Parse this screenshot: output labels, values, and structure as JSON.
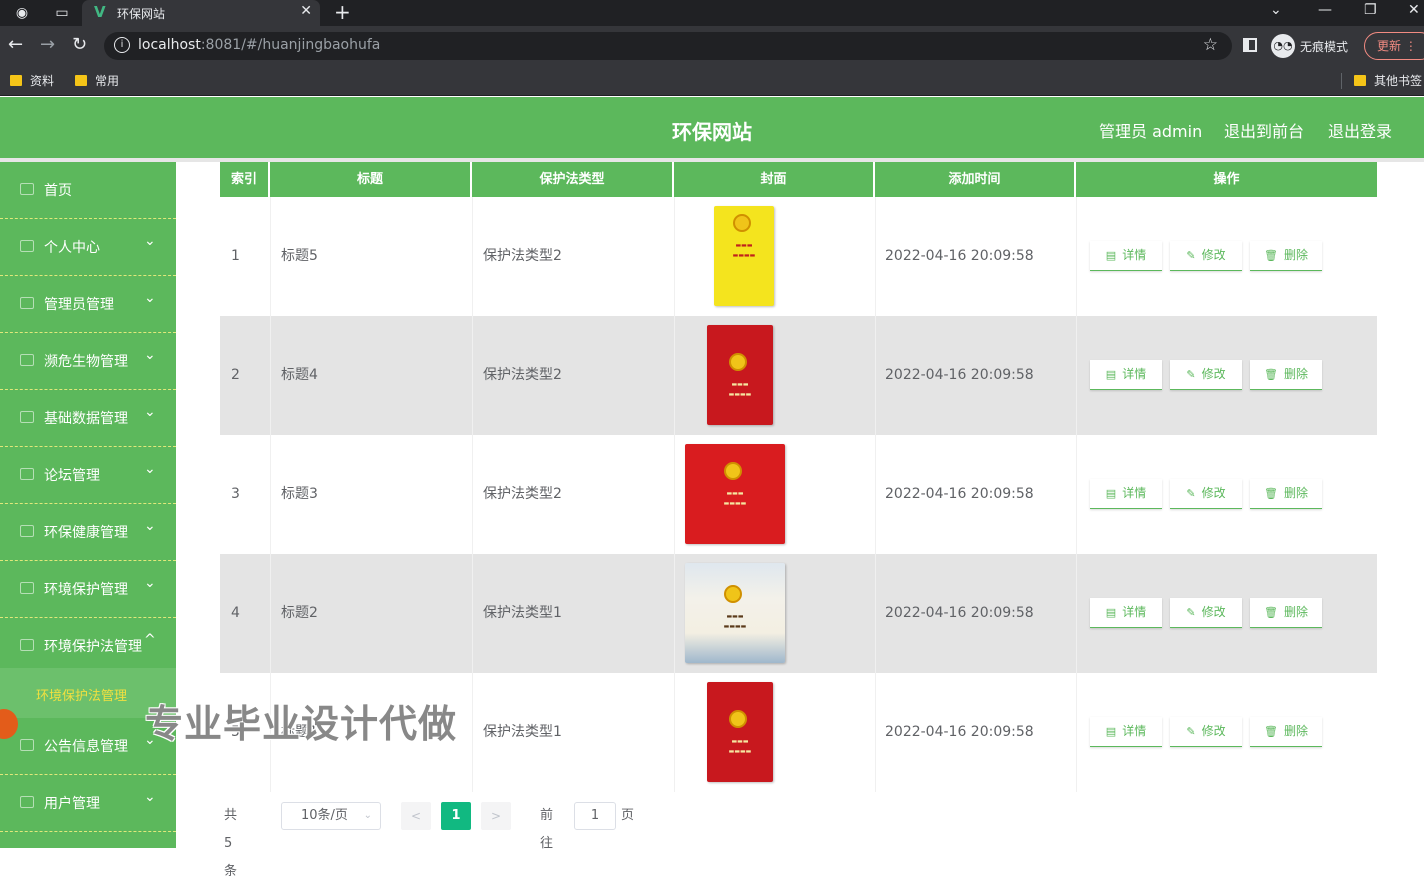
{
  "browser": {
    "tab_title": "环保网站",
    "url_host": "localhost",
    "url_rest": ":8081/#/huanjingbaohufa",
    "incognito_label": "无痕模式",
    "update_label": "更新",
    "bookmarks": [
      "资料",
      "常用"
    ],
    "other_bookmarks": "其他书签"
  },
  "header": {
    "title": "环保网站",
    "admin_label": "管理员 admin",
    "to_front_label": "退出到前台",
    "logout_label": "退出登录"
  },
  "sidebar": {
    "items": [
      {
        "label": "首页",
        "arrow": ""
      },
      {
        "label": "个人中心",
        "arrow": "⌄"
      },
      {
        "label": "管理员管理",
        "arrow": "⌄"
      },
      {
        "label": "濒危生物管理",
        "arrow": "⌄"
      },
      {
        "label": "基础数据管理",
        "arrow": "⌄"
      },
      {
        "label": "论坛管理",
        "arrow": "⌄"
      },
      {
        "label": "环保健康管理",
        "arrow": "⌄"
      },
      {
        "label": "环境保护管理",
        "arrow": "⌄"
      },
      {
        "label": "环境保护法管理",
        "arrow": "^"
      },
      {
        "label": "公告信息管理",
        "arrow": "⌄"
      },
      {
        "label": "用户管理",
        "arrow": "⌄"
      }
    ],
    "active_sub": "环境保护法管理"
  },
  "table": {
    "columns": [
      "索引",
      "标题",
      "保护法类型",
      "封面",
      "添加时间",
      "操作"
    ],
    "rows": [
      {
        "index": "1",
        "title": "标题5",
        "type": "保护法类型2",
        "time": "2022-04-16 20:09:58",
        "cover": "yellow-book"
      },
      {
        "index": "2",
        "title": "标题4",
        "type": "保护法类型2",
        "time": "2022-04-16 20:09:58",
        "cover": "red-book"
      },
      {
        "index": "3",
        "title": "标题3",
        "type": "保护法类型2",
        "time": "2022-04-16 20:09:58",
        "cover": "red-wide-book"
      },
      {
        "index": "4",
        "title": "标题2",
        "type": "保护法类型1",
        "time": "2022-04-16 20:09:58",
        "cover": "white-book"
      },
      {
        "index": "5",
        "title": "标题1",
        "type": "保护法类型1",
        "time": "2022-04-16 20:09:58",
        "cover": "red-book"
      }
    ],
    "actions": {
      "detail": "详情",
      "edit": "修改",
      "delete": "删除"
    }
  },
  "pagination": {
    "total_label": "共 5 条",
    "page_size": "10条/页",
    "current_page": "1",
    "goto_label": "前往",
    "goto_value": "1",
    "page_suffix": "页"
  },
  "watermark": "专业毕业设计代做",
  "colors": {
    "accent": "#5cb85c",
    "page_active": "#11b981",
    "submenu_text": "#f0e040"
  }
}
